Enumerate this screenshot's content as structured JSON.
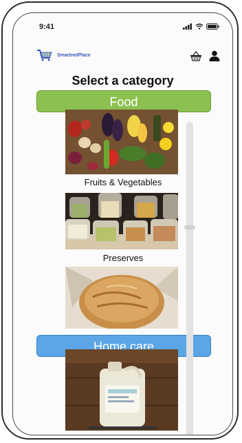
{
  "status_bar": {
    "time": "9:41"
  },
  "header": {
    "logo_text": "SmartnetPlace"
  },
  "page": {
    "title": "Select a category"
  },
  "categories": [
    {
      "label": "Food",
      "color": "#8cc152",
      "items": [
        {
          "label": "Fruits & Vegetables"
        },
        {
          "label": "Preserves"
        },
        {
          "label": ""
        }
      ]
    },
    {
      "label": "Home care",
      "color": "#5aa6e6",
      "items": [
        {
          "label": ""
        }
      ]
    }
  ],
  "icons": [
    "cart-logo-icon",
    "basket-icon",
    "user-icon",
    "signal-icon",
    "wifi-icon",
    "battery-icon"
  ]
}
